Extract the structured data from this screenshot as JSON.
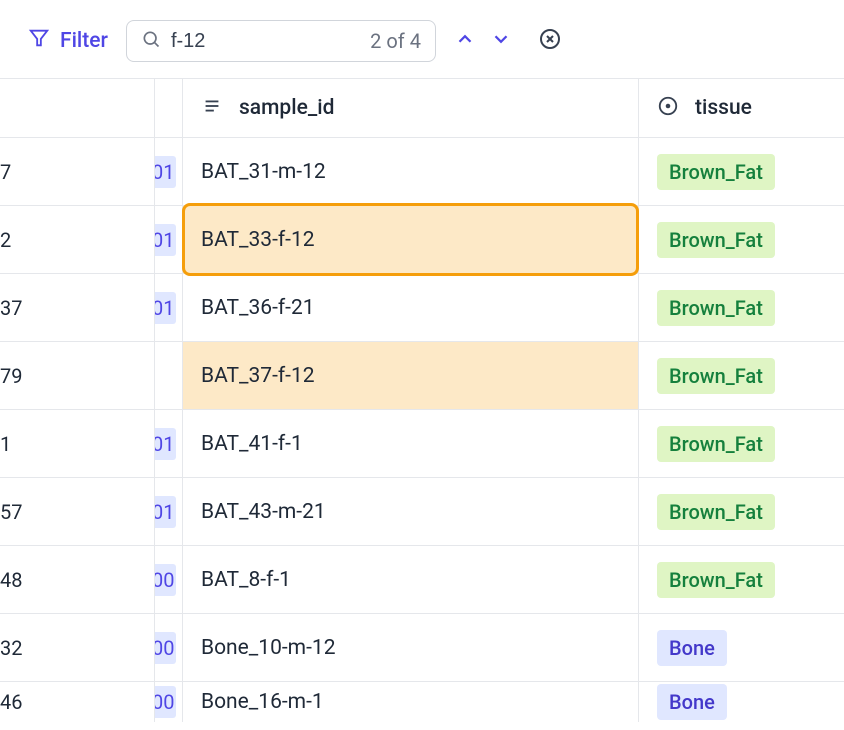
{
  "toolbar": {
    "filter_label": "Filter",
    "search_value": "f-12",
    "search_count": "2 of 4"
  },
  "columns": {
    "sample_id": "sample_id",
    "tissue": "tissue"
  },
  "rows": [
    {
      "left": "7",
      "gap": "01",
      "gap_bg": true,
      "sample": "BAT_31-m-12",
      "tissue": "Brown_Fat",
      "tissue_class": "tag-brown-fat",
      "match": "none"
    },
    {
      "left": "2",
      "gap": "01",
      "gap_bg": true,
      "sample": "BAT_33-f-12",
      "tissue": "Brown_Fat",
      "tissue_class": "tag-brown-fat",
      "match": "active"
    },
    {
      "left": "37",
      "gap": "01",
      "gap_bg": true,
      "sample": "BAT_36-f-21",
      "tissue": "Brown_Fat",
      "tissue_class": "tag-brown-fat",
      "match": "none"
    },
    {
      "left": "79",
      "gap": "",
      "gap_bg": false,
      "sample": "BAT_37-f-12",
      "tissue": "Brown_Fat",
      "tissue_class": "tag-brown-fat",
      "match": "highlight"
    },
    {
      "left": "1",
      "gap": "01",
      "gap_bg": true,
      "sample": "BAT_41-f-1",
      "tissue": "Brown_Fat",
      "tissue_class": "tag-brown-fat",
      "match": "none"
    },
    {
      "left": "57",
      "gap": "01",
      "gap_bg": true,
      "sample": "BAT_43-m-21",
      "tissue": "Brown_Fat",
      "tissue_class": "tag-brown-fat",
      "match": "none"
    },
    {
      "left": "48",
      "gap": "00",
      "gap_bg": true,
      "sample": "BAT_8-f-1",
      "tissue": "Brown_Fat",
      "tissue_class": "tag-brown-fat",
      "match": "none"
    },
    {
      "left": "32",
      "gap": "00",
      "gap_bg": true,
      "sample": "Bone_10-m-12",
      "tissue": "Bone",
      "tissue_class": "tag-bone",
      "match": "none"
    },
    {
      "left": "46",
      "gap": "00",
      "gap_bg": true,
      "sample": "Bone_16-m-1",
      "tissue": "Bone",
      "tissue_class": "tag-bone",
      "match": "none",
      "partial": true
    }
  ]
}
